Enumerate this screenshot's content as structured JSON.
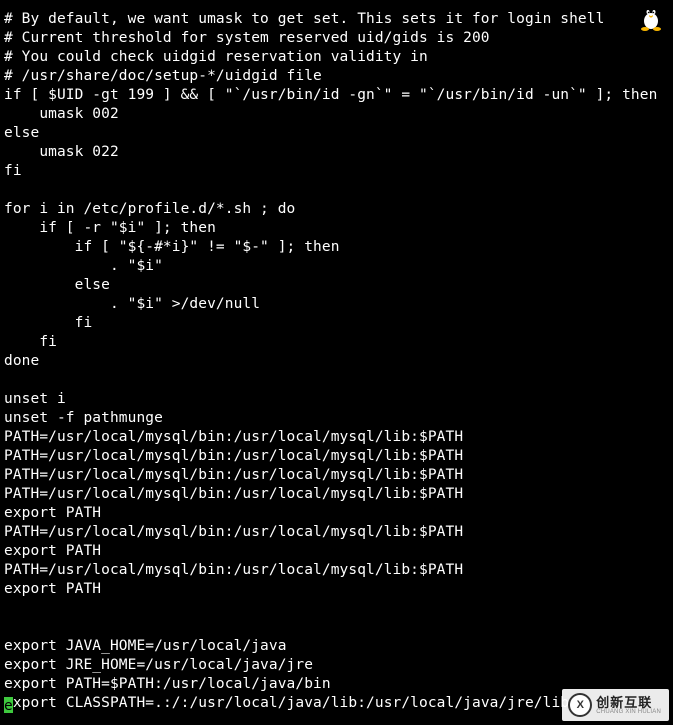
{
  "terminal": {
    "lines": [
      "# By default, we want umask to get set. This sets it for login shell",
      "# Current threshold for system reserved uid/gids is 200",
      "# You could check uidgid reservation validity in",
      "# /usr/share/doc/setup-*/uidgid file",
      "if [ $UID -gt 199 ] && [ \"`/usr/bin/id -gn`\" = \"`/usr/bin/id -un`\" ]; then",
      "    umask 002",
      "else",
      "    umask 022",
      "fi",
      "",
      "for i in /etc/profile.d/*.sh ; do",
      "    if [ -r \"$i\" ]; then",
      "        if [ \"${-#*i}\" != \"$-\" ]; then",
      "            . \"$i\"",
      "        else",
      "            . \"$i\" >/dev/null",
      "        fi",
      "    fi",
      "done",
      "",
      "unset i",
      "unset -f pathmunge",
      "PATH=/usr/local/mysql/bin:/usr/local/mysql/lib:$PATH",
      "PATH=/usr/local/mysql/bin:/usr/local/mysql/lib:$PATH",
      "PATH=/usr/local/mysql/bin:/usr/local/mysql/lib:$PATH",
      "PATH=/usr/local/mysql/bin:/usr/local/mysql/lib:$PATH",
      "export PATH",
      "PATH=/usr/local/mysql/bin:/usr/local/mysql/lib:$PATH",
      "export PATH",
      "PATH=/usr/local/mysql/bin:/usr/local/mysql/lib:$PATH",
      "export PATH",
      "",
      "",
      "export JAVA_HOME=/usr/local/java",
      "export JRE_HOME=/usr/local/java/jre",
      "export PATH=$PATH:/usr/local/java/bin"
    ],
    "cursor_line_prefix": "e",
    "cursor_line_rest": "xport CLASSPATH=.:/:/usr/local/java/lib:/usr/local/java/jre/lib"
  },
  "icons": {
    "penguin": "tux-penguin-icon"
  },
  "watermark": {
    "logo_letter": "X",
    "zh": "创新互联",
    "en": "CHUANG XIN HULIAN"
  }
}
